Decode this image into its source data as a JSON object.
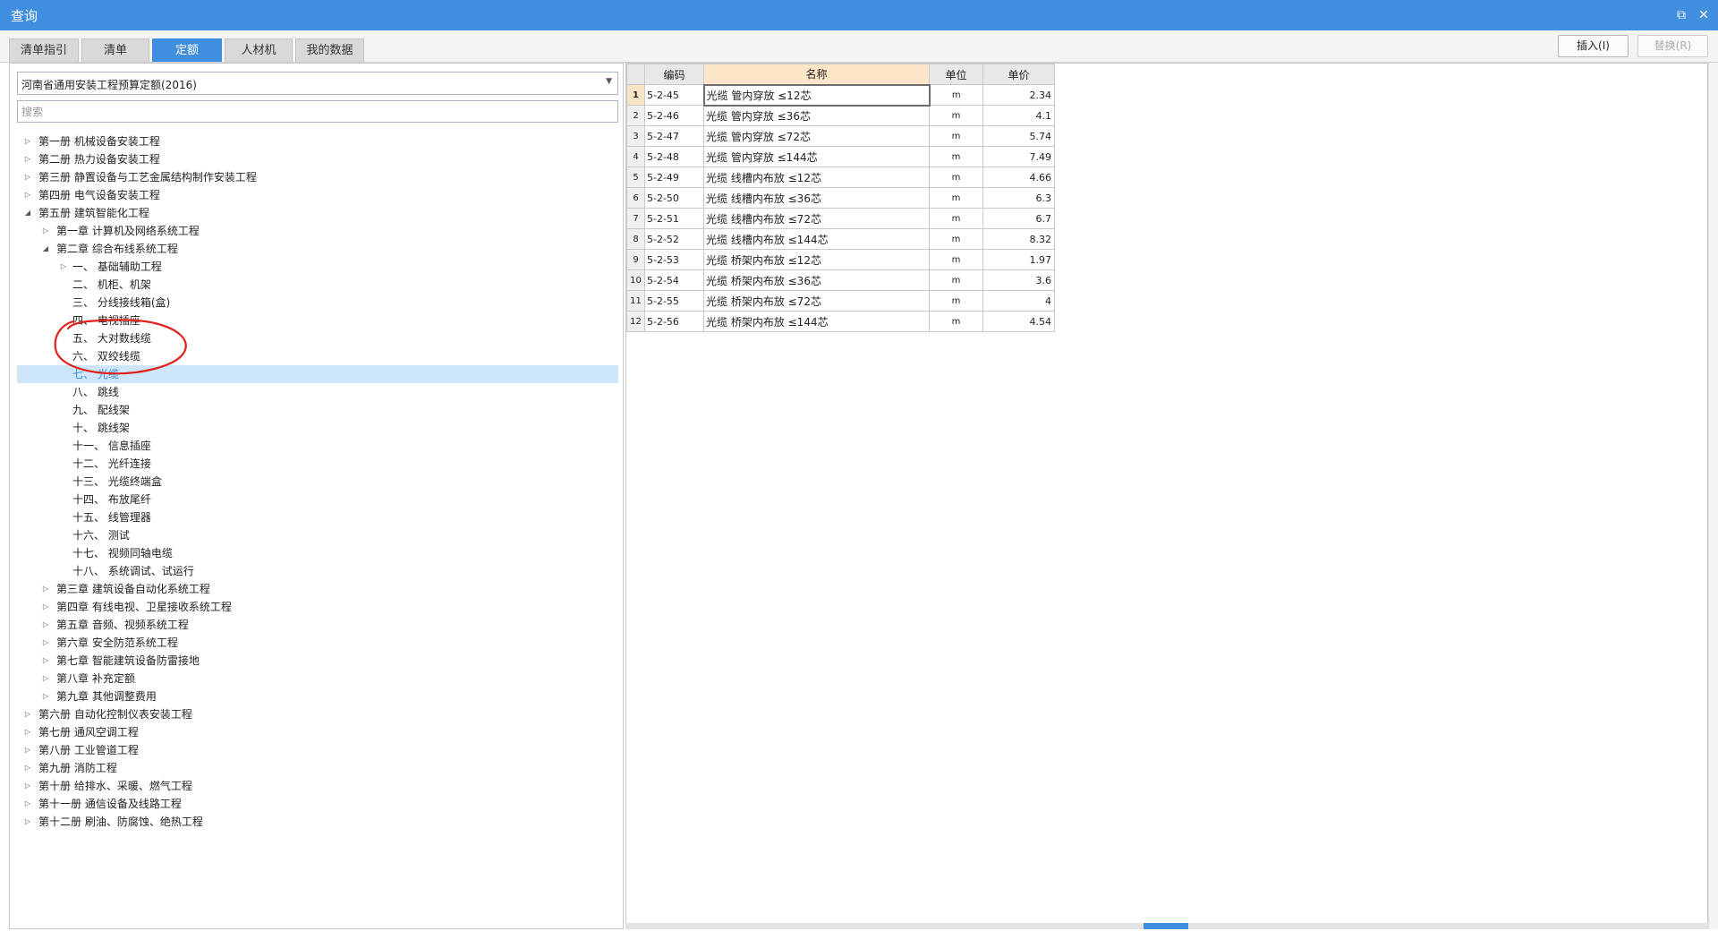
{
  "window": {
    "title": "查询"
  },
  "tabs": [
    {
      "label": "清单指引",
      "active": false
    },
    {
      "label": "清单",
      "active": false
    },
    {
      "label": "定额",
      "active": true
    },
    {
      "label": "人材机",
      "active": false
    },
    {
      "label": "我的数据",
      "active": false
    }
  ],
  "toolbar": {
    "insert_label": "插入(I)",
    "replace_label": "替换(R)"
  },
  "library_select": {
    "value": "河南省通用安装工程预算定额(2016)"
  },
  "search": {
    "placeholder": "搜索"
  },
  "tree": [
    {
      "label": "第一册 机械设备安装工程",
      "level": 0,
      "toggle": "collapsed"
    },
    {
      "label": "第二册 热力设备安装工程",
      "level": 0,
      "toggle": "collapsed"
    },
    {
      "label": "第三册 静置设备与工艺金属结构制作安装工程",
      "level": 0,
      "toggle": "collapsed"
    },
    {
      "label": "第四册 电气设备安装工程",
      "level": 0,
      "toggle": "collapsed"
    },
    {
      "label": "第五册 建筑智能化工程",
      "level": 0,
      "toggle": "expanded"
    },
    {
      "label": "第一章 计算机及网络系统工程",
      "level": 1,
      "toggle": "collapsed"
    },
    {
      "label": "第二章 综合布线系统工程",
      "level": 1,
      "toggle": "expanded"
    },
    {
      "label": "一、 基础辅助工程",
      "level": 2,
      "toggle": "collapsed"
    },
    {
      "label": "二、 机柜、机架",
      "level": 2,
      "toggle": "none"
    },
    {
      "label": "三、 分线接线箱(盒)",
      "level": 2,
      "toggle": "none"
    },
    {
      "label": "四、 电视插座",
      "level": 2,
      "toggle": "none"
    },
    {
      "label": "五、 大对数线缆",
      "level": 2,
      "toggle": "none"
    },
    {
      "label": "六、 双绞线缆",
      "level": 2,
      "toggle": "none"
    },
    {
      "label": "七、 光缆",
      "level": 2,
      "toggle": "none",
      "selected": true
    },
    {
      "label": "八、 跳线",
      "level": 2,
      "toggle": "none"
    },
    {
      "label": "九、 配线架",
      "level": 2,
      "toggle": "none"
    },
    {
      "label": "十、 跳线架",
      "level": 2,
      "toggle": "none"
    },
    {
      "label": "十一、 信息插座",
      "level": 2,
      "toggle": "none"
    },
    {
      "label": "十二、 光纤连接",
      "level": 2,
      "toggle": "none"
    },
    {
      "label": "十三、 光缆终端盒",
      "level": 2,
      "toggle": "none"
    },
    {
      "label": "十四、 布放尾纤",
      "level": 2,
      "toggle": "none"
    },
    {
      "label": "十五、 线管理器",
      "level": 2,
      "toggle": "none"
    },
    {
      "label": "十六、 测试",
      "level": 2,
      "toggle": "none"
    },
    {
      "label": "十七、 视频同轴电缆",
      "level": 2,
      "toggle": "none"
    },
    {
      "label": "十八、 系统调试、试运行",
      "level": 2,
      "toggle": "none"
    },
    {
      "label": "第三章 建筑设备自动化系统工程",
      "level": 1,
      "toggle": "collapsed"
    },
    {
      "label": "第四章 有线电视、卫星接收系统工程",
      "level": 1,
      "toggle": "collapsed"
    },
    {
      "label": "第五章 音频、视频系统工程",
      "level": 1,
      "toggle": "collapsed"
    },
    {
      "label": "第六章 安全防范系统工程",
      "level": 1,
      "toggle": "collapsed"
    },
    {
      "label": "第七章 智能建筑设备防雷接地",
      "level": 1,
      "toggle": "collapsed"
    },
    {
      "label": "第八章 补充定额",
      "level": 1,
      "toggle": "collapsed"
    },
    {
      "label": "第九章 其他调整费用",
      "level": 1,
      "toggle": "collapsed"
    },
    {
      "label": "第六册 自动化控制仪表安装工程",
      "level": 0,
      "toggle": "collapsed"
    },
    {
      "label": "第七册 通风空调工程",
      "level": 0,
      "toggle": "collapsed"
    },
    {
      "label": "第八册 工业管道工程",
      "level": 0,
      "toggle": "collapsed"
    },
    {
      "label": "第九册 消防工程",
      "level": 0,
      "toggle": "collapsed"
    },
    {
      "label": "第十册 给排水、采暖、燃气工程",
      "level": 0,
      "toggle": "collapsed"
    },
    {
      "label": "第十一册 通信设备及线路工程",
      "level": 0,
      "toggle": "collapsed"
    },
    {
      "label": "第十二册 刷油、防腐蚀、绝热工程",
      "level": 0,
      "toggle": "collapsed"
    }
  ],
  "grid": {
    "headers": {
      "code": "编码",
      "name": "名称",
      "unit": "单位",
      "price": "单价"
    },
    "rows": [
      {
        "num": "1",
        "code": "5-2-45",
        "name": "光缆 管内穿放 ≤12芯",
        "unit": "m",
        "price": "2.34"
      },
      {
        "num": "2",
        "code": "5-2-46",
        "name": "光缆 管内穿放 ≤36芯",
        "unit": "m",
        "price": "4.1"
      },
      {
        "num": "3",
        "code": "5-2-47",
        "name": "光缆 管内穿放 ≤72芯",
        "unit": "m",
        "price": "5.74"
      },
      {
        "num": "4",
        "code": "5-2-48",
        "name": "光缆 管内穿放 ≤144芯",
        "unit": "m",
        "price": "7.49"
      },
      {
        "num": "5",
        "code": "5-2-49",
        "name": "光缆 线槽内布放 ≤12芯",
        "unit": "m",
        "price": "4.66"
      },
      {
        "num": "6",
        "code": "5-2-50",
        "name": "光缆 线槽内布放 ≤36芯",
        "unit": "m",
        "price": "6.3"
      },
      {
        "num": "7",
        "code": "5-2-51",
        "name": "光缆 线槽内布放 ≤72芯",
        "unit": "m",
        "price": "6.7"
      },
      {
        "num": "8",
        "code": "5-2-52",
        "name": "光缆 线槽内布放 ≤144芯",
        "unit": "m",
        "price": "8.32"
      },
      {
        "num": "9",
        "code": "5-2-53",
        "name": "光缆 桥架内布放 ≤12芯",
        "unit": "m",
        "price": "1.97"
      },
      {
        "num": "10",
        "code": "5-2-54",
        "name": "光缆 桥架内布放 ≤36芯",
        "unit": "m",
        "price": "3.6"
      },
      {
        "num": "11",
        "code": "5-2-55",
        "name": "光缆 桥架内布放 ≤72芯",
        "unit": "m",
        "price": "4"
      },
      {
        "num": "12",
        "code": "5-2-56",
        "name": "光缆 桥架内布放 ≤144芯",
        "unit": "m",
        "price": "4.54"
      }
    ]
  },
  "colors": {
    "accent": "#3f8ee0",
    "selection": "#cde6fa",
    "annotation": "#e0221b",
    "name_header": "#fde6c7"
  }
}
